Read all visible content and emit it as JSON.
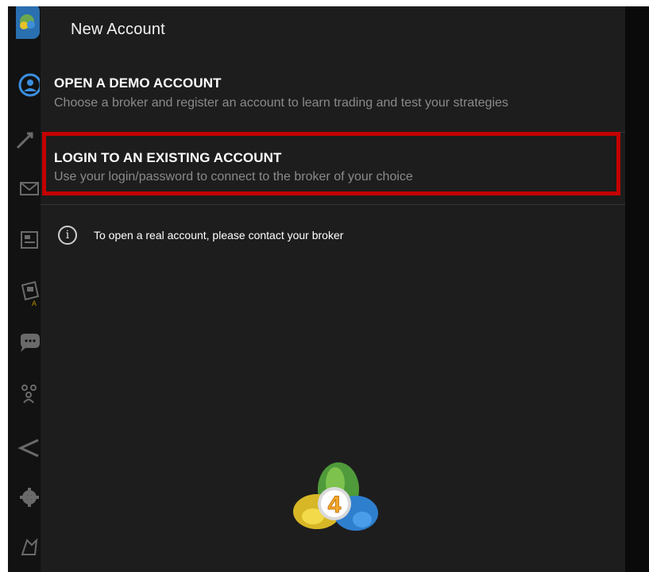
{
  "header": {
    "title": "New Account"
  },
  "menu": {
    "demo": {
      "heading": "OPEN A DEMO ACCOUNT",
      "description": "Choose a broker and register an account to learn trading and test your strategies"
    },
    "login": {
      "heading": "LOGIN TO AN EXISTING ACCOUNT",
      "description": "Use your login/password to connect to the broker of your choice"
    }
  },
  "info": {
    "text": "To open a real account, please contact your broker"
  },
  "logo": {
    "numeral": "4"
  },
  "sidebar_icons": [
    "app-logo-icon",
    "accounts-icon",
    "trade-icon",
    "mail-icon",
    "news-icon",
    "tradays-icon",
    "chat-icon",
    "community-icon",
    "messages-icon",
    "settings-icon",
    "traders-icon"
  ],
  "colors": {
    "background": "#1d1d1d",
    "highlight": "#c40000",
    "text": "#ffffff",
    "muted": "#8a8a8a"
  }
}
